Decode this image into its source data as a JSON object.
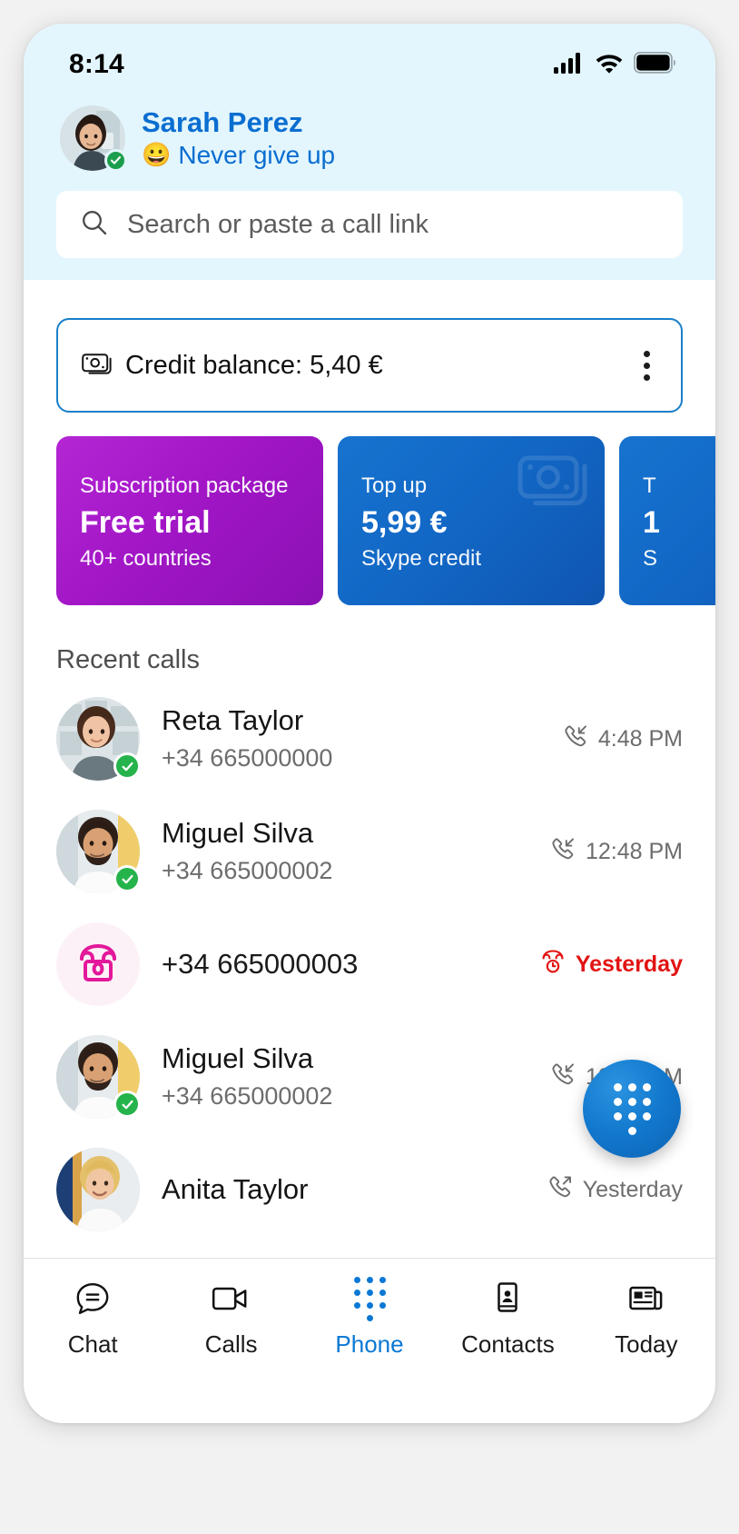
{
  "status_bar": {
    "time": "8:14",
    "icons": [
      "cellular-signal-icon",
      "wifi-icon",
      "battery-icon"
    ]
  },
  "profile": {
    "name": "Sarah Perez",
    "mood_emoji": "😀",
    "mood_text": "Never give up",
    "presence": "available",
    "avatar": "user-avatar"
  },
  "search": {
    "placeholder": "Search or paste a call link",
    "value": "",
    "icon": "search-icon"
  },
  "credit": {
    "icon": "banknote-icon",
    "label": "Credit balance: 5,40 €",
    "menu_icon": "more-vertical-icon",
    "border_color": "#1a7fc9"
  },
  "promos": [
    {
      "top": "Subscription package",
      "big": "Free trial",
      "sub": "40+ countries",
      "color": "#a216c6",
      "watermark": "none"
    },
    {
      "top": "Top up",
      "big": "5,99 €",
      "sub": "Skype credit",
      "color": "#1266c4",
      "watermark": "banknote-icon"
    },
    {
      "top": "T",
      "big": "1",
      "sub": "S",
      "color": "#1266c4",
      "watermark": "banknote-icon"
    }
  ],
  "recent_calls": {
    "title": "Recent calls",
    "rows": [
      {
        "name": "Reta Taylor",
        "number": "+34 665000000",
        "time": "4:48 PM",
        "direction": "incoming",
        "direction_icon": "call-incoming-icon",
        "missed": false,
        "avatar": "contact-photo",
        "presence": "available"
      },
      {
        "name": "Miguel Silva",
        "number": "+34 665000002",
        "time": "12:48 PM",
        "direction": "incoming",
        "direction_icon": "call-incoming-icon",
        "missed": false,
        "avatar": "contact-photo",
        "presence": "available"
      },
      {
        "name": "",
        "number": "+34 665000003",
        "time": "Yesterday",
        "direction": "missed",
        "direction_icon": "call-missed-icon",
        "missed": true,
        "avatar": "phone-glyph",
        "presence": "none"
      },
      {
        "name": "Miguel Silva",
        "number": "+34 665000002",
        "time": "12:48 PM",
        "direction": "incoming",
        "direction_icon": "call-incoming-icon",
        "missed": false,
        "avatar": "contact-photo",
        "presence": "available"
      },
      {
        "name": "Anita Taylor",
        "number": "",
        "time": "Yesterday",
        "direction": "outgoing",
        "direction_icon": "call-outgoing-icon",
        "missed": false,
        "avatar": "contact-photo",
        "presence": "none"
      }
    ]
  },
  "fab": {
    "icon": "dialpad-icon",
    "color": "#1279ce"
  },
  "bottom_nav": {
    "active": "Phone",
    "accent_color": "#0a78d4",
    "items": [
      {
        "label": "Chat",
        "icon": "chat-bubble-icon"
      },
      {
        "label": "Calls",
        "icon": "video-camera-icon"
      },
      {
        "label": "Phone",
        "icon": "dialpad-icon"
      },
      {
        "label": "Contacts",
        "icon": "contact-card-icon"
      },
      {
        "label": "Today",
        "icon": "news-icon"
      }
    ]
  }
}
